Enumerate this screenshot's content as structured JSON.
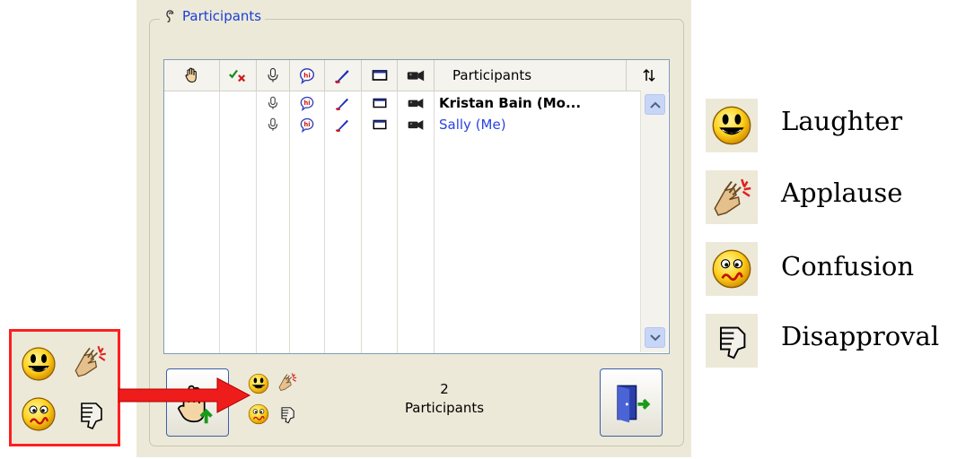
{
  "panel": {
    "title": "Participants",
    "header": {
      "participants_col": "Participants",
      "columns": [
        "raise-hand",
        "approve-deny",
        "microphone",
        "chat",
        "annotate",
        "screen",
        "video"
      ]
    },
    "rows": [
      {
        "name": "Kristan Bain (Mo...",
        "style": "bold"
      },
      {
        "name": "Sally (Me)",
        "style": "me"
      }
    ],
    "count_number": "2",
    "count_label": "Participants"
  },
  "legend": [
    {
      "icon": "laughter-icon",
      "label": "Laughter"
    },
    {
      "icon": "applause-icon",
      "label": "Applause"
    },
    {
      "icon": "confusion-icon",
      "label": "Confusion"
    },
    {
      "icon": "disapproval-icon",
      "label": "Disapproval"
    }
  ],
  "colors": {
    "highlight": "#ff1f1f",
    "panel_bg": "#ece9d8",
    "link_blue": "#2a43e0"
  }
}
